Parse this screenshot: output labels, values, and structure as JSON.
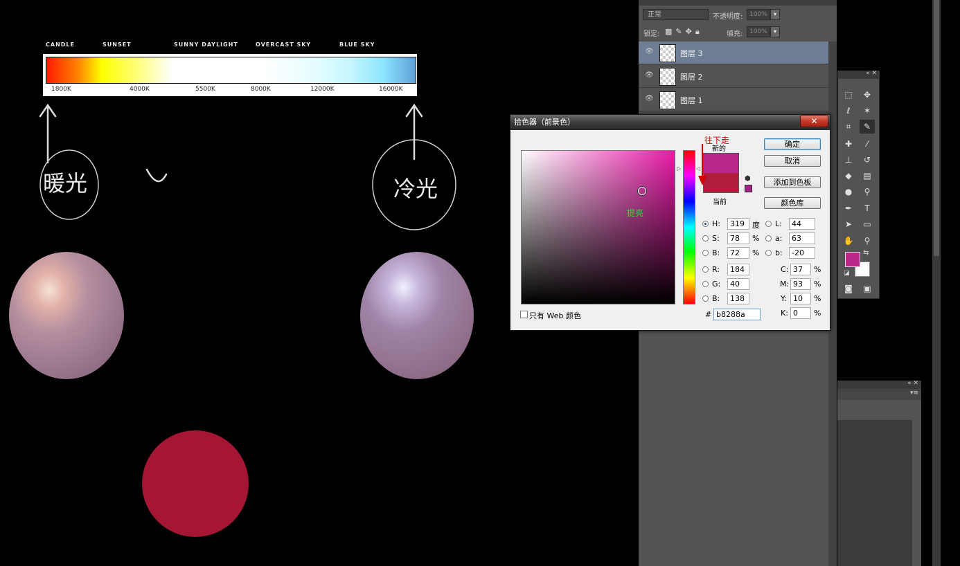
{
  "canvas": {
    "temperature_labels": [
      "CANDLE",
      "SUNSET",
      "SUNNY DAYLIGHT",
      "OVERCAST SKY",
      "BLUE SKY"
    ],
    "kelvin_labels": [
      "1800K",
      "4000K",
      "5500K",
      "8000K",
      "12000K",
      "16000K"
    ],
    "sketch_note_left": "暖光",
    "sketch_note_right": "冷光"
  },
  "layers_panel": {
    "blend_mode": "正常",
    "opacity_label": "不透明度:",
    "opacity_value": "100%",
    "lock_label": "锁定:",
    "fill_label": "填充:",
    "fill_value": "100%",
    "layers": [
      {
        "name": "图层 3",
        "selected": true
      },
      {
        "name": "图层 2",
        "selected": false
      },
      {
        "name": "图层 1",
        "selected": false
      }
    ]
  },
  "color_picker": {
    "title": "拾色器（前景色）",
    "new_label": "新的",
    "current_label": "当前",
    "new_color": "#b8288a",
    "current_color": "#b01d3a",
    "buttons": {
      "ok": "确定",
      "cancel": "取消",
      "add_swatch": "添加到色板",
      "libraries": "颜色库"
    },
    "hsb": {
      "H": "319",
      "S": "78",
      "B": "72",
      "h_unit": "度",
      "pct": "%"
    },
    "lab": {
      "L": "44",
      "a": "63",
      "b": "-20"
    },
    "rgb": {
      "R": "184",
      "G": "40",
      "B": "138"
    },
    "cmyk": {
      "C": "37",
      "M": "93",
      "Y": "10",
      "K": "0",
      "pct": "%"
    },
    "field_labels": {
      "H": "H:",
      "S": "S:",
      "Bv": "B:",
      "L": "L:",
      "a": "a:",
      "b": "b:",
      "R": "R:",
      "G": "G:",
      "Bb": "B:",
      "C": "C:",
      "M": "M:",
      "Y": "Y:",
      "K": "K:"
    },
    "hex_label": "#",
    "hex_value": "b8288a",
    "web_only_label": "只有 Web 颜色",
    "annotation_down": "往下走",
    "annotation_brighten": "提亮"
  },
  "toolbar": {
    "foreground_color": "#b8288a",
    "background_color": "#ffffff"
  }
}
